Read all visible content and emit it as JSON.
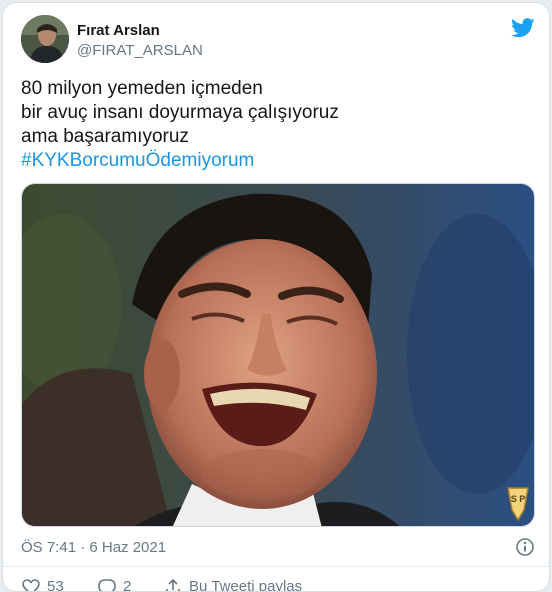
{
  "author": {
    "name": "Fırat Arslan",
    "handle": "@FIRAT_ARSLAN"
  },
  "tweet": {
    "lines": [
      "80 milyon yemeden içmeden",
      "bir avuç insanı doyurmaya çalışıyoruz",
      "ama başaramıyoruz"
    ],
    "hashtag": "#KYKBorcumuÖdemiyorum",
    "timestamp": "ÖS 7:41 · 6 Haz 2021",
    "watermark": "S P"
  },
  "actions": {
    "likes": "53",
    "replies": "2",
    "retweet_label": "Bu Tweeti paylaş"
  },
  "colors": {
    "accent": "#1da1f2",
    "hashtag": "#1b95e0",
    "muted": "#657786"
  },
  "icons": [
    "twitter-bird-icon",
    "info-icon",
    "heart-icon",
    "reply-icon",
    "share-icon"
  ]
}
